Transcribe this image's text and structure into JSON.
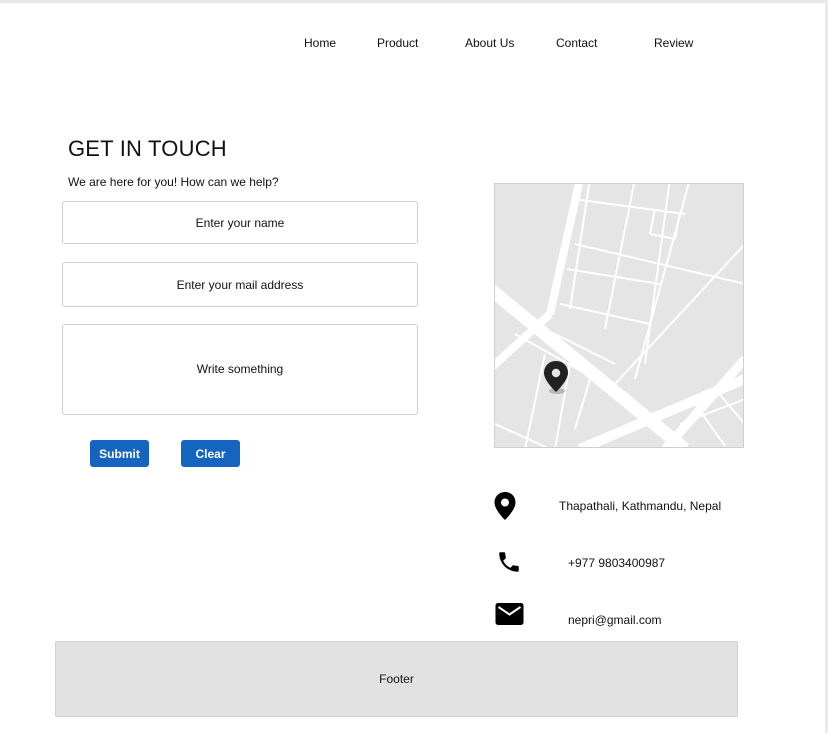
{
  "nav": {
    "items": [
      {
        "label": "Home"
      },
      {
        "label": "Product"
      },
      {
        "label": "About Us"
      },
      {
        "label": "Contact"
      },
      {
        "label": "Review"
      }
    ]
  },
  "contact": {
    "title": "GET IN TOUCH",
    "subtitle": "We are here for you! How can we help?",
    "name_placeholder": "Enter your name",
    "email_placeholder": "Enter your mail address",
    "message_placeholder": "Write something",
    "submit_label": "Submit",
    "clear_label": "Clear"
  },
  "info": {
    "address": "Thapathali, Kathmandu, Nepal",
    "phone": "+977 9803400987",
    "email": "nepri@gmail.com",
    "address_icon": "location-pin-icon",
    "phone_icon": "phone-icon",
    "email_icon": "mail-icon"
  },
  "footer": {
    "label": "Footer"
  },
  "colors": {
    "button": "#1565c0",
    "footer_bg": "#e2e2e2",
    "map_bg": "#e5e5e5"
  }
}
